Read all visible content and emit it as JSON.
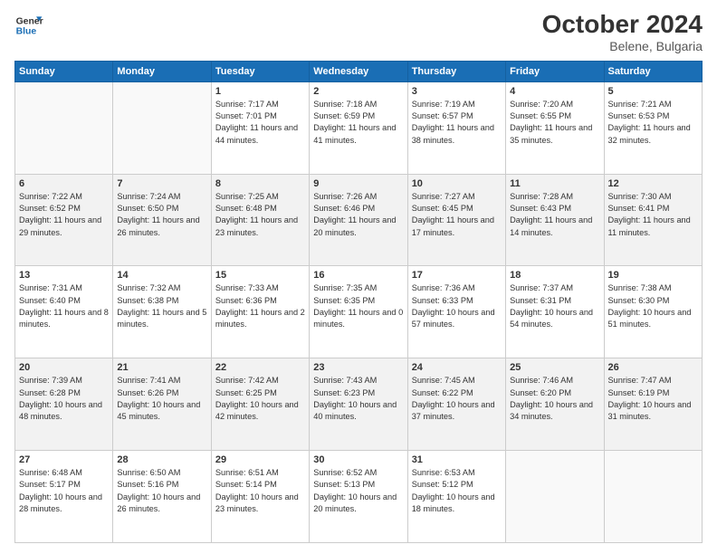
{
  "header": {
    "logo_line1": "General",
    "logo_line2": "Blue",
    "month": "October 2024",
    "location": "Belene, Bulgaria"
  },
  "days_of_week": [
    "Sunday",
    "Monday",
    "Tuesday",
    "Wednesday",
    "Thursday",
    "Friday",
    "Saturday"
  ],
  "weeks": [
    [
      {
        "num": "",
        "sunrise": "",
        "sunset": "",
        "daylight": "",
        "empty": true
      },
      {
        "num": "",
        "sunrise": "",
        "sunset": "",
        "daylight": "",
        "empty": true
      },
      {
        "num": "1",
        "sunrise": "Sunrise: 7:17 AM",
        "sunset": "Sunset: 7:01 PM",
        "daylight": "Daylight: 11 hours and 44 minutes."
      },
      {
        "num": "2",
        "sunrise": "Sunrise: 7:18 AM",
        "sunset": "Sunset: 6:59 PM",
        "daylight": "Daylight: 11 hours and 41 minutes."
      },
      {
        "num": "3",
        "sunrise": "Sunrise: 7:19 AM",
        "sunset": "Sunset: 6:57 PM",
        "daylight": "Daylight: 11 hours and 38 minutes."
      },
      {
        "num": "4",
        "sunrise": "Sunrise: 7:20 AM",
        "sunset": "Sunset: 6:55 PM",
        "daylight": "Daylight: 11 hours and 35 minutes."
      },
      {
        "num": "5",
        "sunrise": "Sunrise: 7:21 AM",
        "sunset": "Sunset: 6:53 PM",
        "daylight": "Daylight: 11 hours and 32 minutes."
      }
    ],
    [
      {
        "num": "6",
        "sunrise": "Sunrise: 7:22 AM",
        "sunset": "Sunset: 6:52 PM",
        "daylight": "Daylight: 11 hours and 29 minutes."
      },
      {
        "num": "7",
        "sunrise": "Sunrise: 7:24 AM",
        "sunset": "Sunset: 6:50 PM",
        "daylight": "Daylight: 11 hours and 26 minutes."
      },
      {
        "num": "8",
        "sunrise": "Sunrise: 7:25 AM",
        "sunset": "Sunset: 6:48 PM",
        "daylight": "Daylight: 11 hours and 23 minutes."
      },
      {
        "num": "9",
        "sunrise": "Sunrise: 7:26 AM",
        "sunset": "Sunset: 6:46 PM",
        "daylight": "Daylight: 11 hours and 20 minutes."
      },
      {
        "num": "10",
        "sunrise": "Sunrise: 7:27 AM",
        "sunset": "Sunset: 6:45 PM",
        "daylight": "Daylight: 11 hours and 17 minutes."
      },
      {
        "num": "11",
        "sunrise": "Sunrise: 7:28 AM",
        "sunset": "Sunset: 6:43 PM",
        "daylight": "Daylight: 11 hours and 14 minutes."
      },
      {
        "num": "12",
        "sunrise": "Sunrise: 7:30 AM",
        "sunset": "Sunset: 6:41 PM",
        "daylight": "Daylight: 11 hours and 11 minutes."
      }
    ],
    [
      {
        "num": "13",
        "sunrise": "Sunrise: 7:31 AM",
        "sunset": "Sunset: 6:40 PM",
        "daylight": "Daylight: 11 hours and 8 minutes."
      },
      {
        "num": "14",
        "sunrise": "Sunrise: 7:32 AM",
        "sunset": "Sunset: 6:38 PM",
        "daylight": "Daylight: 11 hours and 5 minutes."
      },
      {
        "num": "15",
        "sunrise": "Sunrise: 7:33 AM",
        "sunset": "Sunset: 6:36 PM",
        "daylight": "Daylight: 11 hours and 2 minutes."
      },
      {
        "num": "16",
        "sunrise": "Sunrise: 7:35 AM",
        "sunset": "Sunset: 6:35 PM",
        "daylight": "Daylight: 11 hours and 0 minutes."
      },
      {
        "num": "17",
        "sunrise": "Sunrise: 7:36 AM",
        "sunset": "Sunset: 6:33 PM",
        "daylight": "Daylight: 10 hours and 57 minutes."
      },
      {
        "num": "18",
        "sunrise": "Sunrise: 7:37 AM",
        "sunset": "Sunset: 6:31 PM",
        "daylight": "Daylight: 10 hours and 54 minutes."
      },
      {
        "num": "19",
        "sunrise": "Sunrise: 7:38 AM",
        "sunset": "Sunset: 6:30 PM",
        "daylight": "Daylight: 10 hours and 51 minutes."
      }
    ],
    [
      {
        "num": "20",
        "sunrise": "Sunrise: 7:39 AM",
        "sunset": "Sunset: 6:28 PM",
        "daylight": "Daylight: 10 hours and 48 minutes."
      },
      {
        "num": "21",
        "sunrise": "Sunrise: 7:41 AM",
        "sunset": "Sunset: 6:26 PM",
        "daylight": "Daylight: 10 hours and 45 minutes."
      },
      {
        "num": "22",
        "sunrise": "Sunrise: 7:42 AM",
        "sunset": "Sunset: 6:25 PM",
        "daylight": "Daylight: 10 hours and 42 minutes."
      },
      {
        "num": "23",
        "sunrise": "Sunrise: 7:43 AM",
        "sunset": "Sunset: 6:23 PM",
        "daylight": "Daylight: 10 hours and 40 minutes."
      },
      {
        "num": "24",
        "sunrise": "Sunrise: 7:45 AM",
        "sunset": "Sunset: 6:22 PM",
        "daylight": "Daylight: 10 hours and 37 minutes."
      },
      {
        "num": "25",
        "sunrise": "Sunrise: 7:46 AM",
        "sunset": "Sunset: 6:20 PM",
        "daylight": "Daylight: 10 hours and 34 minutes."
      },
      {
        "num": "26",
        "sunrise": "Sunrise: 7:47 AM",
        "sunset": "Sunset: 6:19 PM",
        "daylight": "Daylight: 10 hours and 31 minutes."
      }
    ],
    [
      {
        "num": "27",
        "sunrise": "Sunrise: 6:48 AM",
        "sunset": "Sunset: 5:17 PM",
        "daylight": "Daylight: 10 hours and 28 minutes."
      },
      {
        "num": "28",
        "sunrise": "Sunrise: 6:50 AM",
        "sunset": "Sunset: 5:16 PM",
        "daylight": "Daylight: 10 hours and 26 minutes."
      },
      {
        "num": "29",
        "sunrise": "Sunrise: 6:51 AM",
        "sunset": "Sunset: 5:14 PM",
        "daylight": "Daylight: 10 hours and 23 minutes."
      },
      {
        "num": "30",
        "sunrise": "Sunrise: 6:52 AM",
        "sunset": "Sunset: 5:13 PM",
        "daylight": "Daylight: 10 hours and 20 minutes."
      },
      {
        "num": "31",
        "sunrise": "Sunrise: 6:53 AM",
        "sunset": "Sunset: 5:12 PM",
        "daylight": "Daylight: 10 hours and 18 minutes."
      },
      {
        "num": "",
        "sunrise": "",
        "sunset": "",
        "daylight": "",
        "empty": true
      },
      {
        "num": "",
        "sunrise": "",
        "sunset": "",
        "daylight": "",
        "empty": true
      }
    ]
  ]
}
